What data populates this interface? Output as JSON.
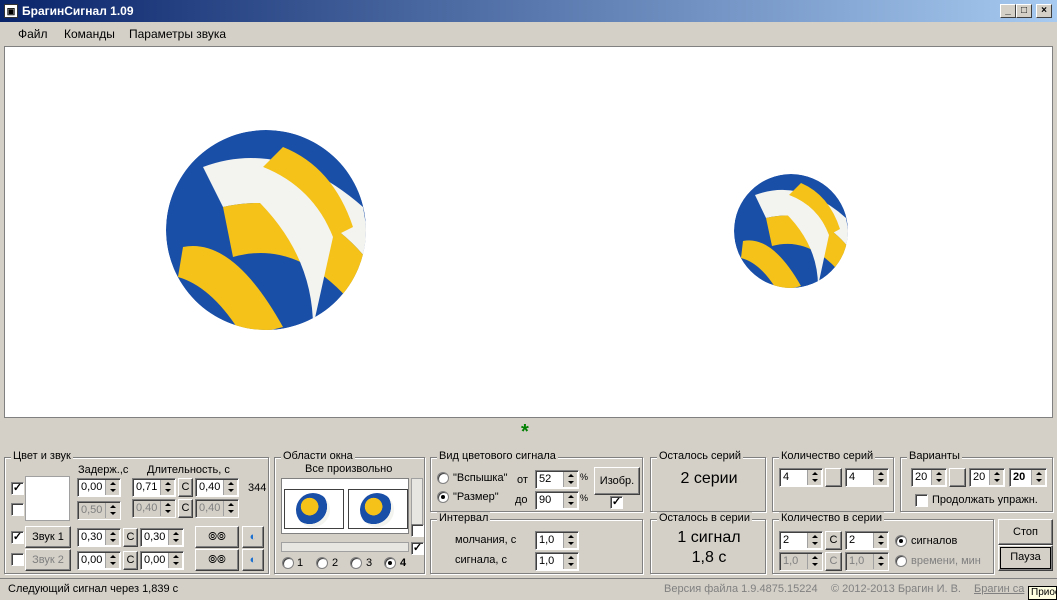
{
  "window": {
    "title": "БрагинСигнал 1.09",
    "min": "_",
    "max": "□",
    "close": "×"
  },
  "menu": [
    "Файл",
    "Команды",
    "Параметры звука"
  ],
  "canvas": {
    "marker": "*"
  },
  "color_sound": {
    "title": "Цвет и звук",
    "delay_header": "Задерж.,с",
    "duration_header": "Длительность, с",
    "row1": {
      "delay": "0,00",
      "dur1": "0,71",
      "c": "C",
      "dur2": "0,40",
      "count": "344"
    },
    "row2": {
      "delay": "0,50",
      "dur1": "0,40",
      "c": "C",
      "dur2": "0,40"
    },
    "row3": {
      "btn": "Звук 1",
      "delay": "0,30",
      "c": "C",
      "dur": "0,30"
    },
    "row4": {
      "btn": "Звук 2",
      "delay": "0,00",
      "c": "C",
      "dur": "0,00"
    }
  },
  "areas": {
    "title": "Области окна",
    "subtitle": "Все произвольно",
    "radios": [
      "1",
      "2",
      "3",
      "4"
    ]
  },
  "signal_type": {
    "title": "Вид цветового сигнала",
    "flash": "\"Вспышка\"",
    "size": "\"Размер\"",
    "from": "от",
    "to": "до",
    "from_val": "52",
    "to_val": "90",
    "pct": "%",
    "image_btn": "Изобр."
  },
  "interval": {
    "title": "Интервал",
    "silence": "молчания, с",
    "signal": "сигнала, с",
    "silence_val": "1,0",
    "signal_val": "1,0"
  },
  "remaining_series": {
    "title": "Осталось серий",
    "value": "2 серии"
  },
  "remaining_in_series": {
    "title": "Осталось в серии",
    "value1": "1 сигнал",
    "value2": "1,8 с"
  },
  "series_count": {
    "title": "Количество серий",
    "a": "4",
    "b": "4"
  },
  "variants": {
    "title": "Варианты",
    "a": "20",
    "b": "20",
    "sel": "20",
    "continue": "Продолжать упражн."
  },
  "in_series": {
    "title": "Количество в серии",
    "a": "2",
    "c": "C",
    "b": "2",
    "a2": "1,0",
    "b2": "1,0",
    "signals": "сигналов",
    "time": "времени, мин"
  },
  "buttons": {
    "stop": "Стоп",
    "pause": "Пауза"
  },
  "tooltip": "Приос",
  "status": {
    "next": "Следующий сигнал через 1,839 с",
    "version": "Версия файла 1.9.4875.15224",
    "copyright": "©  2012-2013  Брагин И. В.",
    "link": "Брагин са"
  }
}
